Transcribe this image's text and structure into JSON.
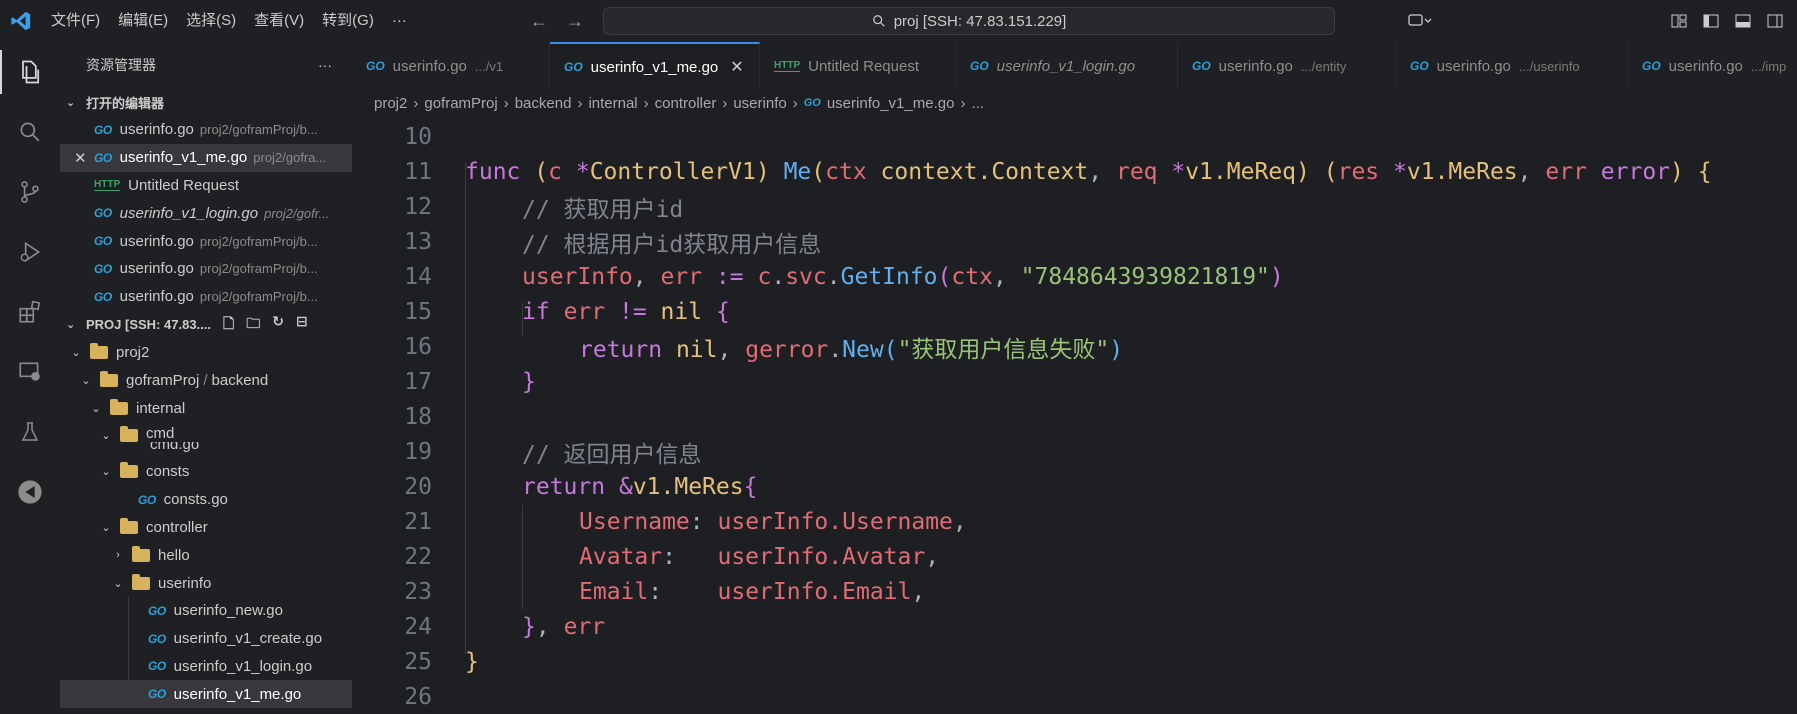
{
  "titlebar": {
    "menu": [
      "文件(F)",
      "编辑(E)",
      "选择(S)",
      "查看(V)",
      "转到(G)",
      "···"
    ],
    "search": "proj [SSH: 47.83.151.229]"
  },
  "sidebar": {
    "header": "资源管理器",
    "open_editors_title": "打开的编辑器",
    "open_editors": [
      {
        "name": "userinfo.go",
        "desc": "proj2/goframProj/b...",
        "type": "go",
        "italic": false
      },
      {
        "name": "userinfo_v1_me.go",
        "desc": "proj2/gofra...",
        "type": "go",
        "italic": false
      },
      {
        "name": "Untitled Request",
        "desc": "",
        "type": "http",
        "italic": false
      },
      {
        "name": "userinfo_v1_login.go",
        "desc": "proj2/gofr...",
        "type": "go",
        "italic": true
      },
      {
        "name": "userinfo.go",
        "desc": "proj2/goframProj/b...",
        "type": "go",
        "italic": false
      },
      {
        "name": "userinfo.go",
        "desc": "proj2/goframProj/b...",
        "type": "go",
        "italic": false
      },
      {
        "name": "userinfo.go",
        "desc": "proj2/goframProj/b...",
        "type": "go",
        "italic": false
      }
    ],
    "project_title": "PROJ [SSH: 47.83....",
    "tree": {
      "proj2": "proj2",
      "goframProj": "goframProj",
      "backend_sep": "/",
      "backend": "backend",
      "internal": "internal",
      "cmd": "cmd",
      "cmd_go": "cmd.go",
      "consts": "consts",
      "consts_go": "consts.go",
      "controller": "controller",
      "hello": "hello",
      "userinfo": "userinfo",
      "files": [
        "userinfo_new.go",
        "userinfo_v1_create.go",
        "userinfo_v1_login.go",
        "userinfo_v1_me.go"
      ]
    }
  },
  "tabs": [
    {
      "name": "userinfo.go",
      "desc": ".../v1",
      "type": "go",
      "active": false,
      "italic": false
    },
    {
      "name": "userinfo_v1_me.go",
      "desc": "",
      "type": "go",
      "active": true,
      "italic": false
    },
    {
      "name": "Untitled Request",
      "desc": "",
      "type": "http",
      "active": false,
      "italic": false
    },
    {
      "name": "userinfo_v1_login.go",
      "desc": "",
      "type": "go",
      "active": false,
      "italic": true
    },
    {
      "name": "userinfo.go",
      "desc": ".../entity",
      "type": "go",
      "active": false,
      "italic": false
    },
    {
      "name": "userinfo.go",
      "desc": ".../userinfo",
      "type": "go",
      "active": false,
      "italic": false
    },
    {
      "name": "userinfo.go",
      "desc": ".../imp",
      "type": "go",
      "active": false,
      "italic": false
    }
  ],
  "breadcrumb": [
    "proj2",
    "goframProj",
    "backend",
    "internal",
    "controller",
    "userinfo",
    "userinfo_v1_me.go",
    "..."
  ],
  "code": {
    "line_numbers": [
      "10",
      "11",
      "12",
      "13",
      "14",
      "15",
      "16",
      "17",
      "18",
      "19",
      "20",
      "21",
      "22",
      "23",
      "24",
      "25",
      "26"
    ],
    "l11": {
      "func": "func",
      "c": "c",
      "star": "*",
      "ctrl": "ControllerV1",
      "me": "Me",
      "ctx": "ctx",
      "ctxpkg": "context.Context",
      "req": "req",
      "reqtype": "v1.MeReq",
      "res": "res",
      "restype": "v1.MeRes",
      "err": "err",
      "errtype": "error"
    },
    "c12": "// 获取用户id",
    "c13": "// 根据用户id获取用户信息",
    "l14": {
      "userInfo": "userInfo",
      "err": "err",
      "op": ":=",
      "recv": "c.svc.",
      "call": "GetInfo",
      "ctx": "ctx",
      "str": "\"7848643939821819\""
    },
    "l15": {
      "if": "if",
      "err": "err",
      "op": "!=",
      "nil": "nil"
    },
    "l16": {
      "ret": "return",
      "nil": "nil",
      "pkg": "gerror",
      "fn": "New",
      "str": "\"获取用户信息失败\""
    },
    "c19": "// 返回用户信息",
    "l20": {
      "ret": "return",
      "amp": "&",
      "type": "v1.MeRes"
    },
    "l21": {
      "key": "Username",
      "val": "userInfo.Username"
    },
    "l22": {
      "key": "Avatar",
      "val": "userInfo.Avatar"
    },
    "l23": {
      "key": "Email",
      "val": "userInfo.Email"
    },
    "l24": {
      "err": "err"
    }
  }
}
